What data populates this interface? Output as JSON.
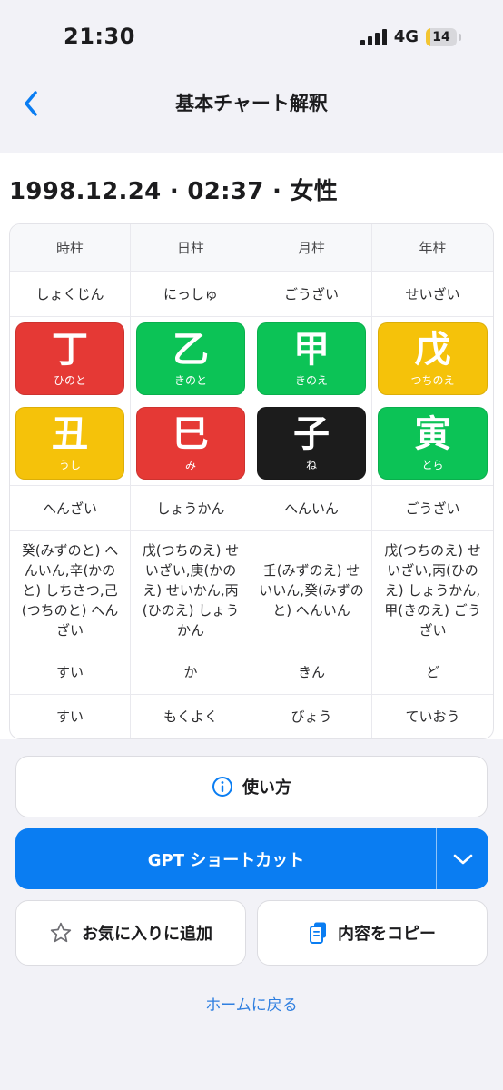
{
  "status_bar": {
    "time": "21:30",
    "network": "4G",
    "battery_level": "14",
    "battery_fraction": 0.14
  },
  "nav": {
    "title": "基本チャート解釈",
    "back_icon": "chevron-left-icon"
  },
  "headline": "1998.12.24 · 02:37 · 女性",
  "chart": {
    "headers": [
      "時柱",
      "日柱",
      "月柱",
      "年柱"
    ],
    "star_row": [
      "しょくじん",
      "にっしゅ",
      "ごうざい",
      "せいざい"
    ],
    "stems": [
      {
        "char": "丁",
        "reading": "ひのと",
        "color": "#e53935"
      },
      {
        "char": "乙",
        "reading": "きのと",
        "color": "#0cc356"
      },
      {
        "char": "甲",
        "reading": "きのえ",
        "color": "#0cc356"
      },
      {
        "char": "戊",
        "reading": "つちのえ",
        "color": "#f5c20a"
      }
    ],
    "branches": [
      {
        "char": "丑",
        "reading": "うし",
        "color": "#f5c20a"
      },
      {
        "char": "巳",
        "reading": "み",
        "color": "#e53935"
      },
      {
        "char": "子",
        "reading": "ね",
        "color": "#1c1c1c"
      },
      {
        "char": "寅",
        "reading": "とら",
        "color": "#0cc356"
      }
    ],
    "branch_star_row": [
      "へんざい",
      "しょうかん",
      "へんいん",
      "ごうざい"
    ],
    "hidden_stems_row": [
      "癸(みずのと) へんいん,辛(かのと) しちさつ,己(つちのと) へんざい",
      "戊(つちのえ) せいざい,庚(かのえ) せいかん,丙(ひのえ) しょうかん",
      "壬(みずのえ) せいいん,癸(みずのと) へんいん",
      "戊(つちのえ) せいざい,丙(ひのえ) しょうかん,甲(きのえ) ごうざい"
    ],
    "element_row": [
      "すい",
      "か",
      "きん",
      "ど"
    ],
    "cycle_row": [
      "すい",
      "もくよく",
      "びょう",
      "ていおう"
    ]
  },
  "buttons": {
    "how_to": {
      "label": "使い方",
      "icon": "info-circle-icon"
    },
    "gpt": {
      "label": "GPT ショートカット",
      "dropdown_icon": "chevron-down-icon"
    },
    "favorite": {
      "label": "お気に入りに追加",
      "icon": "star-outline-icon"
    },
    "copy": {
      "label": "内容をコピー",
      "icon": "clipboard-icon"
    }
  },
  "home_link": "ホームに戻る",
  "colors": {
    "accent": "#0a7df2",
    "link": "#2f7fe0",
    "red": "#e53935",
    "green": "#0cc356",
    "yellow": "#f5c20a",
    "black": "#1c1c1c"
  }
}
